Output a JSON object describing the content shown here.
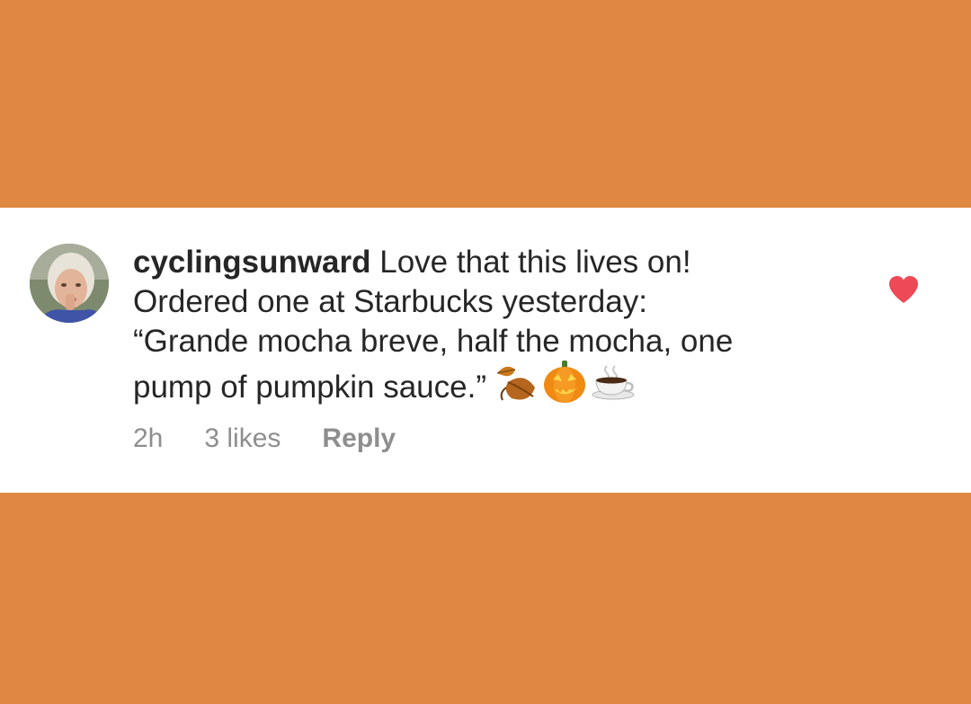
{
  "comment": {
    "username": "cyclingsunward",
    "text_line1": " Love that this lives on!",
    "text_line2": "Ordered one at Starbucks yesterday:",
    "text_line3": "“Grande mocha breve, half the mocha, one",
    "text_line4": "pump of pumpkin sauce.”",
    "emojis": [
      "fallen-leaf-icon",
      "jack-o-lantern-icon",
      "hot-beverage-icon"
    ]
  },
  "meta": {
    "time": "2h",
    "likes": "3 likes",
    "reply": "Reply"
  },
  "colors": {
    "background": "#DE8841",
    "card": "#FFFFFF",
    "text": "#262626",
    "meta_text": "#8E8E8E",
    "heart": "#ED4956"
  },
  "liked": true
}
